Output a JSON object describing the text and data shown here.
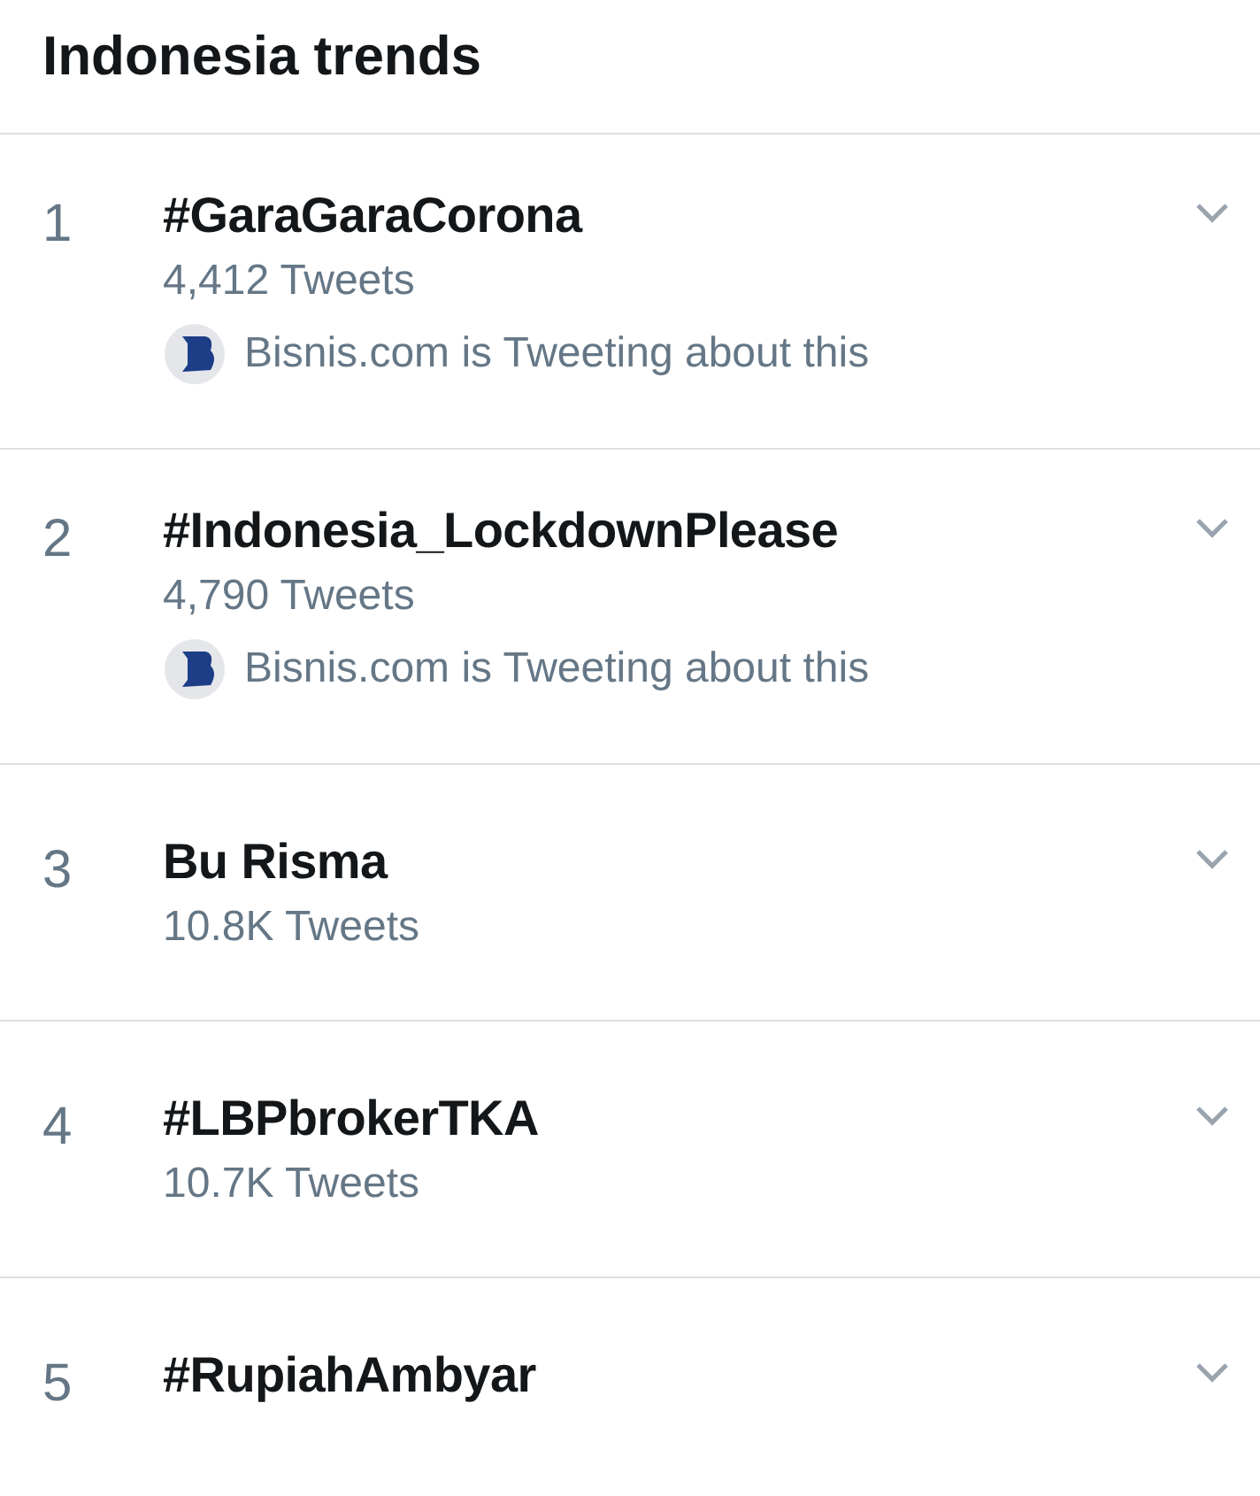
{
  "header": {
    "title": "Indonesia trends"
  },
  "trends": [
    {
      "rank": "1",
      "name": "#GaraGaraCorona",
      "count": "4,412 Tweets",
      "context": "Bisnis.com is Tweeting about this"
    },
    {
      "rank": "2",
      "name": "#Indonesia_LockdownPlease",
      "count": "4,790 Tweets",
      "context": "Bisnis.com is Tweeting about this"
    },
    {
      "rank": "3",
      "name": "Bu Risma",
      "count": "10.8K Tweets"
    },
    {
      "rank": "4",
      "name": "#LBPbrokerTKA",
      "count": "10.7K Tweets"
    },
    {
      "rank": "5",
      "name": "#RupiahAmbyar"
    }
  ]
}
